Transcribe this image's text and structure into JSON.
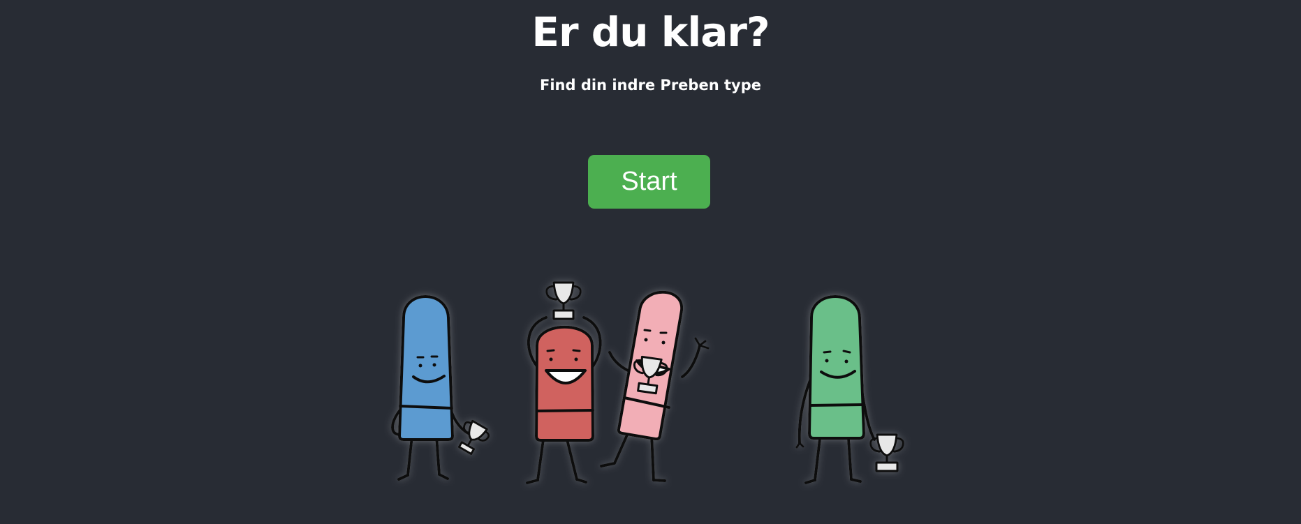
{
  "header": {
    "title": "Er du klar?",
    "subtitle": "Find din indre Preben type"
  },
  "actions": {
    "start_label": "Start"
  },
  "illustration": {
    "characters": [
      {
        "name": "blue",
        "color": "#5b9bd1"
      },
      {
        "name": "red",
        "color": "#d0625e"
      },
      {
        "name": "pink",
        "color": "#f2aeb6"
      },
      {
        "name": "green",
        "color": "#6bbf89"
      }
    ]
  },
  "theme": {
    "background": "#282c34",
    "button_color": "#4caf50",
    "text_color": "#ffffff"
  }
}
